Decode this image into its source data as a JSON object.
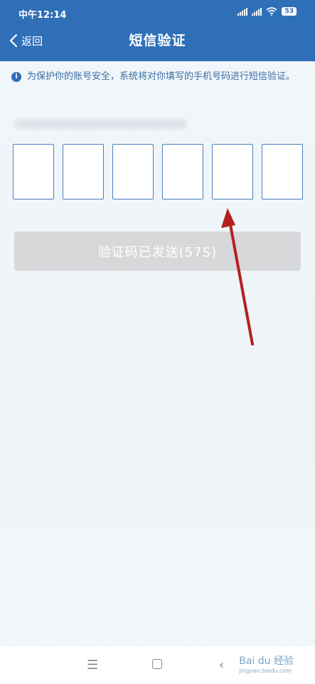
{
  "status": {
    "time": "中午12:14",
    "battery": "53"
  },
  "nav": {
    "back_label": "返回",
    "title": "短信验证"
  },
  "tip": {
    "text": "为保护你的账号安全，系统将对你填写的手机号码进行短信验证。"
  },
  "code": {
    "length": 6
  },
  "send_button": {
    "label": "验证码已发送(57S)"
  },
  "watermark": {
    "brand": "Bai du 经验",
    "url": "jingyan.baidu.com"
  },
  "colors": {
    "header": "#2f6fb8",
    "button_disabled": "#d7d8da",
    "arrow": "#b3201f"
  }
}
